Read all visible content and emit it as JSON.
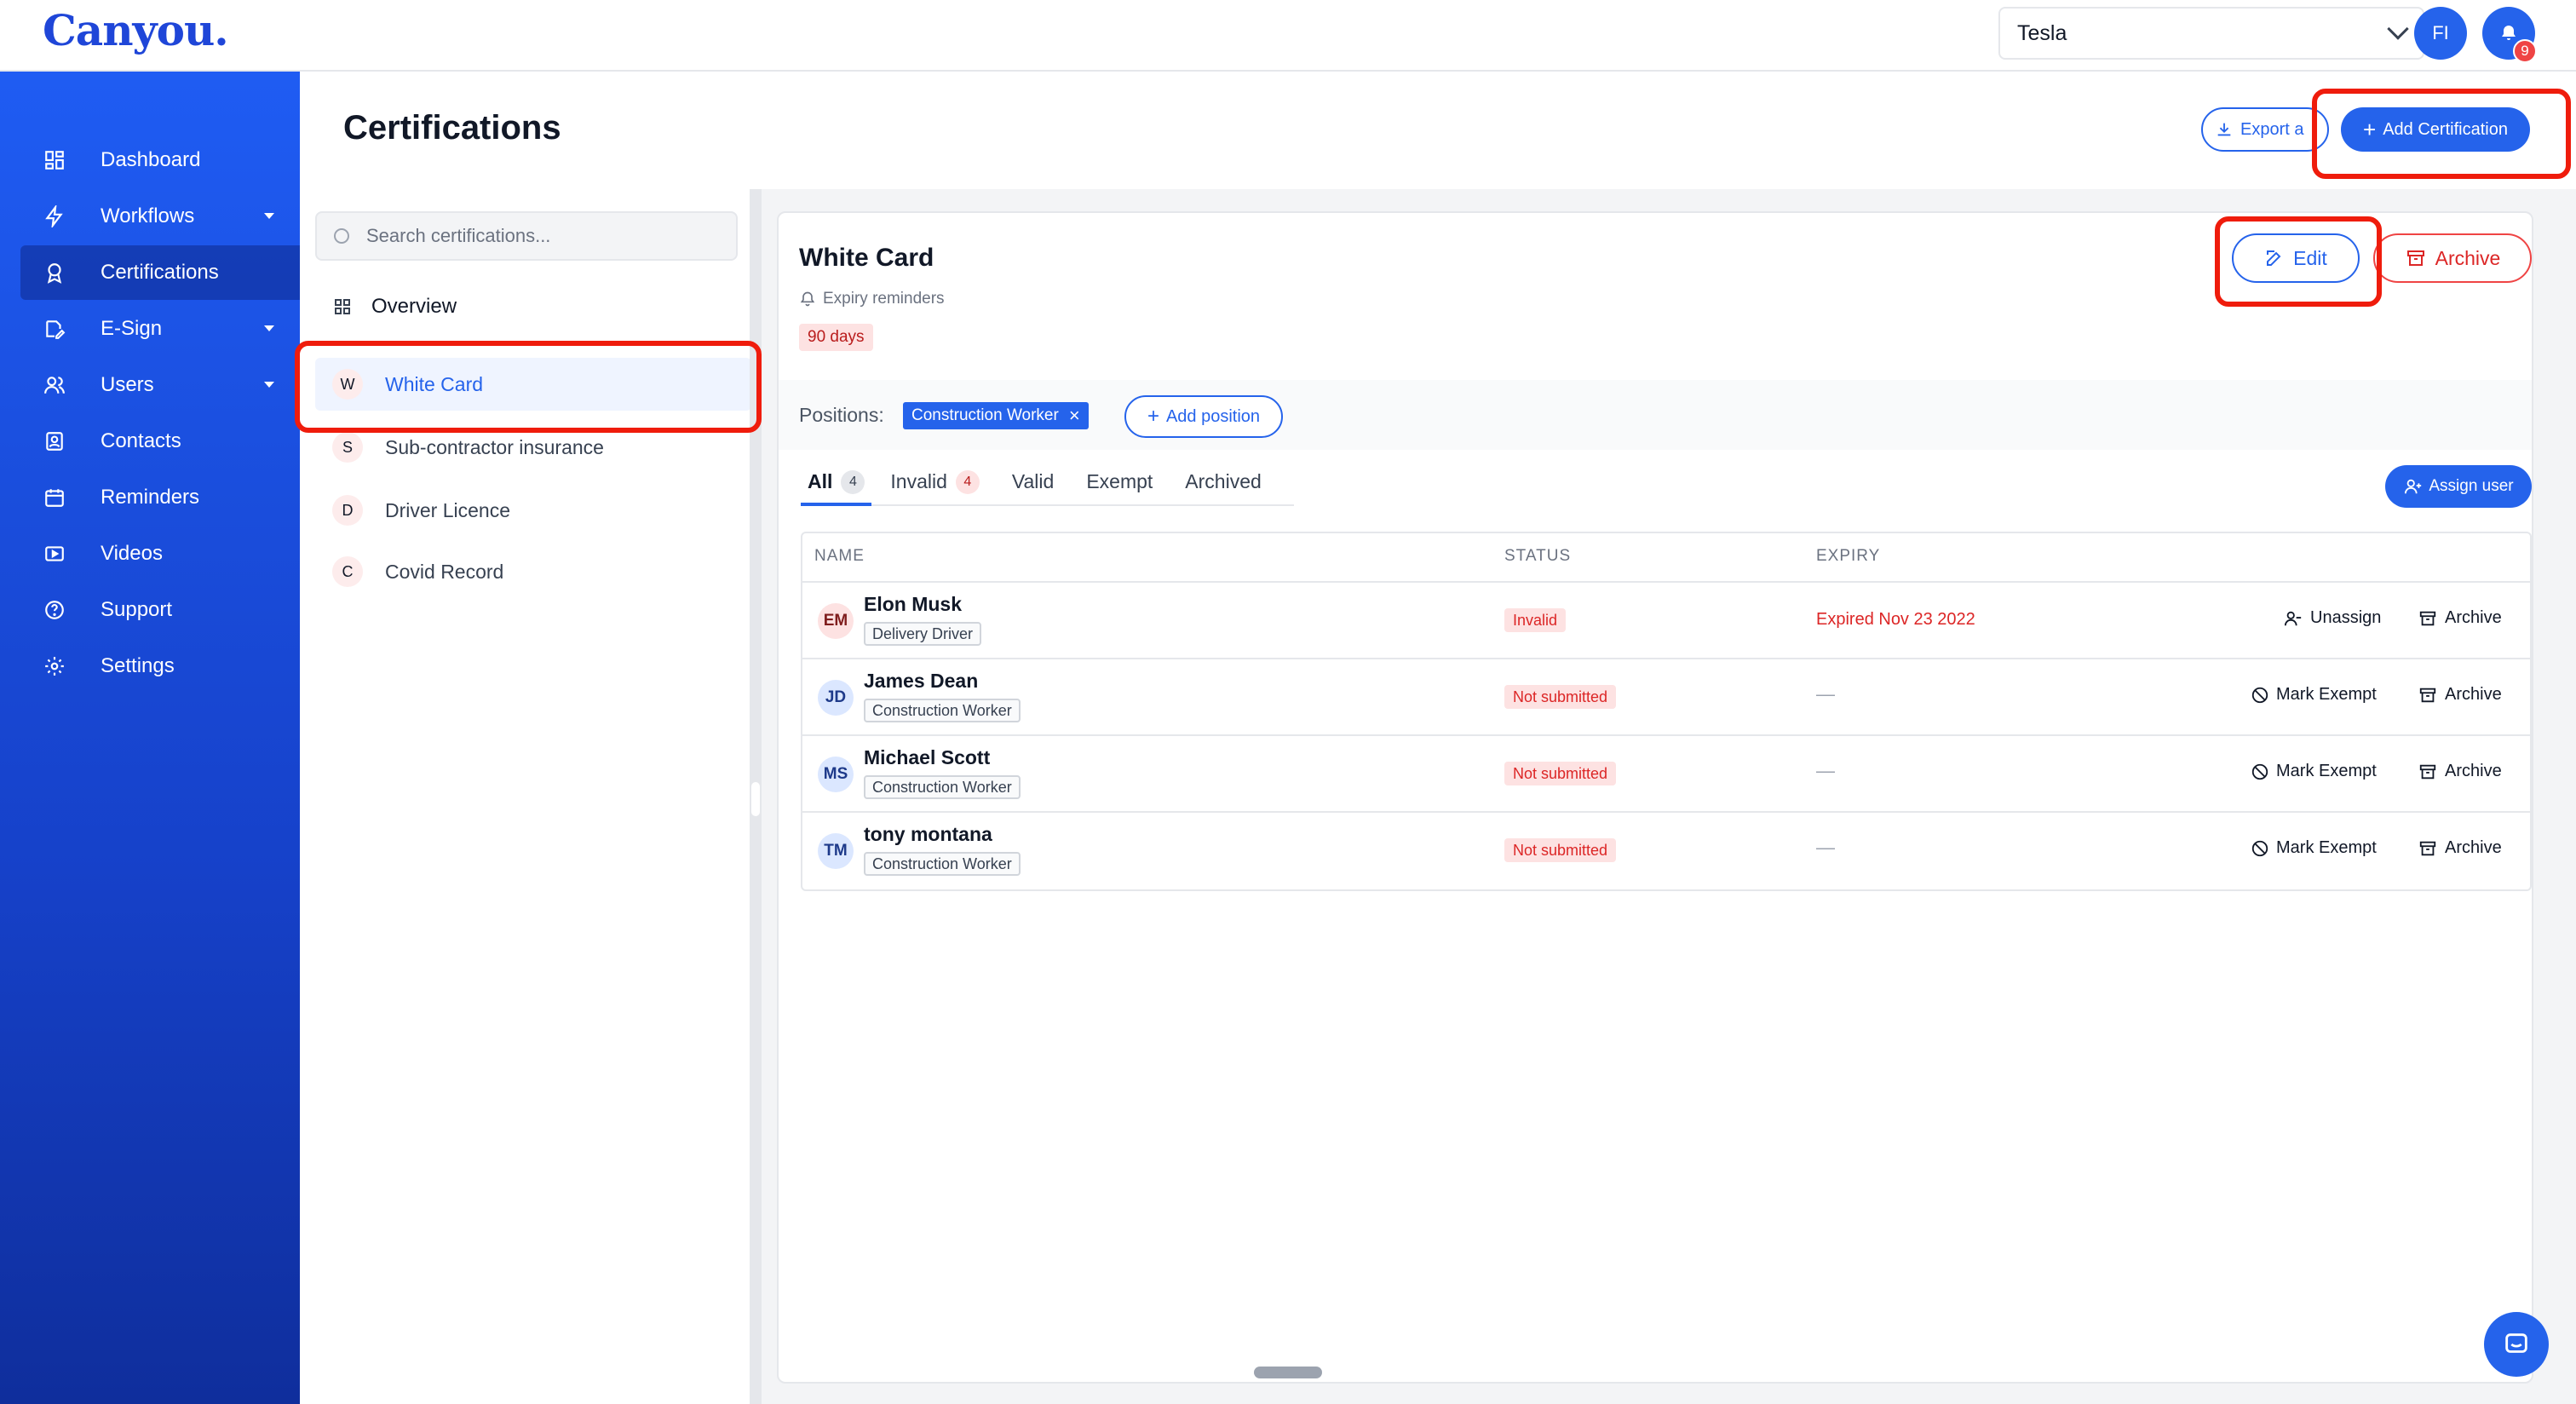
{
  "app": {
    "logo": "Canyou."
  },
  "header": {
    "org_selected": "Tesla",
    "user_initials": "FI",
    "notification_count": "9"
  },
  "sidebar": {
    "items": [
      {
        "label": "Dashboard",
        "icon": "dashboard-icon"
      },
      {
        "label": "Workflows",
        "icon": "lightning-icon",
        "has_caret": true
      },
      {
        "label": "Certifications",
        "icon": "award-icon",
        "active": true
      },
      {
        "label": "E-Sign",
        "icon": "signature-icon",
        "has_caret": true
      },
      {
        "label": "Users",
        "icon": "users-icon",
        "has_caret": true
      },
      {
        "label": "Contacts",
        "icon": "contacts-icon"
      },
      {
        "label": "Reminders",
        "icon": "calendar-icon"
      },
      {
        "label": "Videos",
        "icon": "video-icon"
      },
      {
        "label": "Support",
        "icon": "help-icon"
      },
      {
        "label": "Settings",
        "icon": "gear-icon"
      }
    ]
  },
  "page": {
    "title": "Certifications",
    "export_label": "Export a",
    "add_certification_label": "Add Certification"
  },
  "list": {
    "search_placeholder": "Search certifications...",
    "overview_label": "Overview",
    "certifications": [
      {
        "initial": "W",
        "label": "White Card",
        "selected": true
      },
      {
        "initial": "S",
        "label": "Sub-contractor insurance"
      },
      {
        "initial": "D",
        "label": "Driver Licence"
      },
      {
        "initial": "C",
        "label": "Covid Record"
      }
    ]
  },
  "detail": {
    "title": "White Card",
    "expiry_label": "Expiry reminders",
    "expiry_days": "90 days",
    "edit_label": "Edit",
    "archive_label": "Archive",
    "positions_label": "Positions:",
    "positions": [
      "Construction Worker"
    ],
    "add_position_label": "Add position",
    "tabs": [
      {
        "label": "All",
        "count": "4",
        "active": true
      },
      {
        "label": "Invalid",
        "count": "4"
      },
      {
        "label": "Valid"
      },
      {
        "label": "Exempt"
      },
      {
        "label": "Archived"
      }
    ],
    "assign_user_label": "Assign user",
    "columns": [
      "NAME",
      "STATUS",
      "EXPIRY"
    ],
    "rows": [
      {
        "initials": "EM",
        "name": "Elon Musk",
        "position": "Delivery Driver",
        "status": "Invalid",
        "expiry": "Expired Nov 23 2022",
        "action1": "Unassign",
        "action2": "Archive"
      },
      {
        "initials": "JD",
        "name": "James Dean",
        "position": "Construction Worker",
        "status": "Not submitted",
        "expiry": "—",
        "action1": "Mark Exempt",
        "action2": "Archive"
      },
      {
        "initials": "MS",
        "name": "Michael Scott",
        "position": "Construction Worker",
        "status": "Not submitted",
        "expiry": "—",
        "action1": "Mark Exempt",
        "action2": "Archive"
      },
      {
        "initials": "TM",
        "name": "tony montana",
        "position": "Construction Worker",
        "status": "Not submitted",
        "expiry": "—",
        "action1": "Mark Exempt",
        "action2": "Archive"
      }
    ]
  },
  "colors": {
    "accent": "#2563eb",
    "danger": "#dc2626",
    "highlight": "#ef1c0c"
  }
}
